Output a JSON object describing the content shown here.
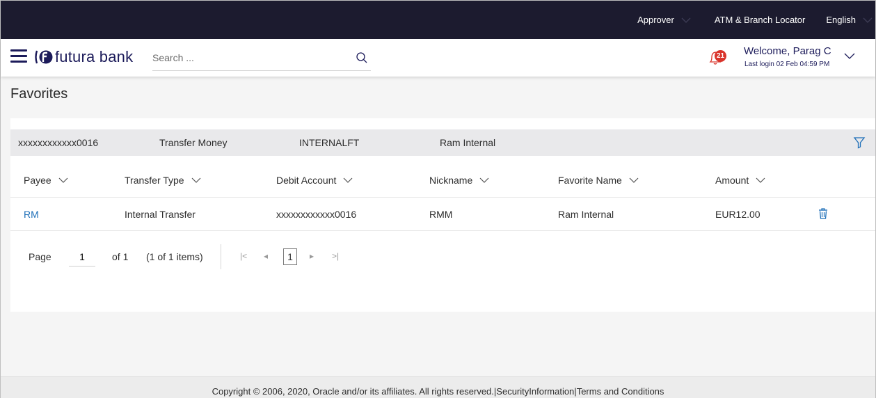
{
  "topbar": {
    "role": "Approver",
    "atm_locator": "ATM & Branch Locator",
    "language": "English"
  },
  "header": {
    "logo_text": "futura bank",
    "search_placeholder": "Search ...",
    "notification_count": "21",
    "welcome": "Welcome, Parag C",
    "last_login": "Last login 02 Feb 04:59 PM"
  },
  "page": {
    "title": "Favorites"
  },
  "filter_bar": {
    "account": "xxxxxxxxxxxx0016",
    "transaction": "Transfer Money",
    "type": "INTERNALFT",
    "favorite": "Ram Internal"
  },
  "table": {
    "headers": [
      "Payee",
      "Transfer Type",
      "Debit Account",
      "Nickname",
      "Favorite Name",
      "Amount"
    ],
    "rows": [
      {
        "payee": "RM",
        "transfer_type": "Internal Transfer",
        "debit_account": "xxxxxxxxxxxx0016",
        "nickname": "RMM",
        "favorite_name": "Ram Internal",
        "amount": "EUR12.00"
      }
    ]
  },
  "pagination": {
    "page_label": "Page",
    "page_value": "1",
    "of_label": "of 1",
    "items_label": "(1 of 1 items)",
    "current_page": "1"
  },
  "footer": {
    "copyright": "Copyright © 2006, 2020, Oracle and/or its affiliates. All rights reserved.",
    "security": "SecurityInformation",
    "terms": "Terms and Conditions"
  },
  "colors": {
    "topbar": "#1c1b2f",
    "brand": "#1c1b5a",
    "link": "#1e6fb8",
    "badge": "#d9342b"
  }
}
